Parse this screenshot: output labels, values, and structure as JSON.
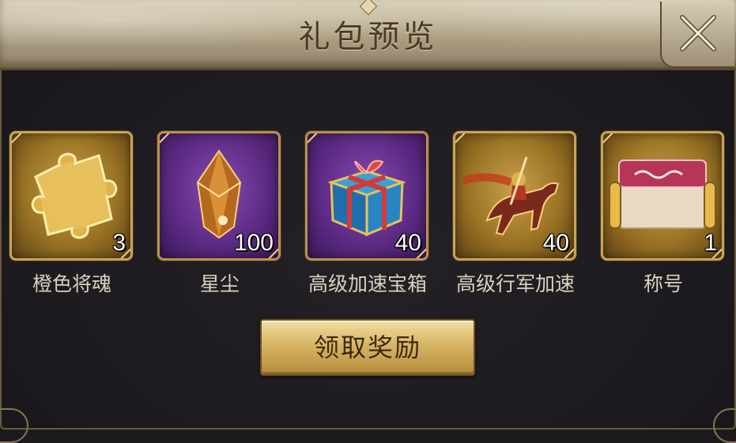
{
  "dialog": {
    "title": "礼包预览",
    "claim_label": "领取奖励"
  },
  "items": [
    {
      "name": "橙色将魂",
      "count": "3",
      "icon": "puzzle-piece-icon",
      "frame": "gold"
    },
    {
      "name": "星尘",
      "count": "100",
      "icon": "crystal-icon",
      "frame": "purple"
    },
    {
      "name": "高级加速宝箱",
      "count": "40",
      "icon": "gift-box-icon",
      "frame": "purple"
    },
    {
      "name": "高级行军加速",
      "count": "40",
      "icon": "cavalry-rider-icon",
      "frame": "gold"
    },
    {
      "name": "称号",
      "count": "1",
      "icon": "title-scroll-icon",
      "frame": "gold"
    }
  ],
  "colors": {
    "frame_gold": "#c9a35a",
    "button_gold": "#d7b565",
    "label_text": "#d9d2c0"
  }
}
